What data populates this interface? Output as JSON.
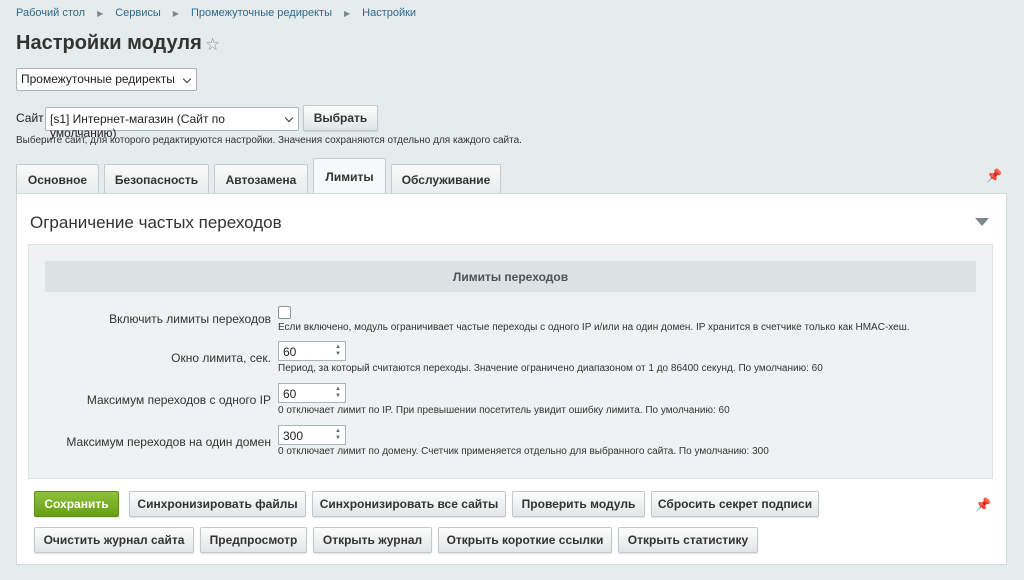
{
  "breadcrumb": [
    "Рабочий стол",
    "Сервисы",
    "Промежуточные редиректы",
    "Настройки"
  ],
  "page_title": "Настройки модуля",
  "module_select": "Промежуточные редиректы",
  "site": {
    "label": "Сайт",
    "value": "[s1] Интернет-магазин (Сайт по умолчанию)",
    "choose_button": "Выбрать",
    "hint": "Выберите сайт, для которого редактируются настройки. Значения сохраняются отдельно для каждого сайта."
  },
  "tabs": [
    "Основное",
    "Безопасность",
    "Автозамена",
    "Лимиты",
    "Обслуживание"
  ],
  "active_tab": "Лимиты",
  "section": {
    "title": "Ограничение частых переходов",
    "group_title": "Лимиты переходов",
    "fields": [
      {
        "label": "Включить лимиты переходов",
        "type": "checkbox",
        "checked": false,
        "hint": "Если включено, модуль ограничивает частые переходы с одного IP и/или на один домен. IP хранится в счетчике только как HMAC-хеш."
      },
      {
        "label": "Окно лимита, сек.",
        "type": "number",
        "value": "60",
        "hint": "Период, за который считаются переходы. Значение ограничено диапазоном от 1 до 86400 секунд. По умолчанию: 60"
      },
      {
        "label": "Максимум переходов с одного IP",
        "type": "number",
        "value": "60",
        "hint": "0 отключает лимит по IP. При превышении посетитель увидит ошибку лимита. По умолчанию: 60"
      },
      {
        "label": "Максимум переходов на один домен",
        "type": "number",
        "value": "300",
        "hint": "0 отключает лимит по домену. Счетчик применяется отдельно для выбранного сайта. По умолчанию: 300"
      }
    ]
  },
  "actions": {
    "save": "Сохранить",
    "sync_files": "Синхронизировать файлы",
    "sync_sites": "Синхронизировать все сайты",
    "check_module": "Проверить модуль",
    "reset_secret": "Сбросить секрет подписи",
    "clear_log": "Очистить журнал сайта",
    "preview": "Предпросмотр",
    "open_log": "Открыть журнал",
    "open_short_links": "Открыть короткие ссылки",
    "open_stats": "Открыть статистику"
  },
  "colors": {
    "save_button": "#7cb127",
    "background": "#e6ebec",
    "link": "#2d6a8f"
  }
}
